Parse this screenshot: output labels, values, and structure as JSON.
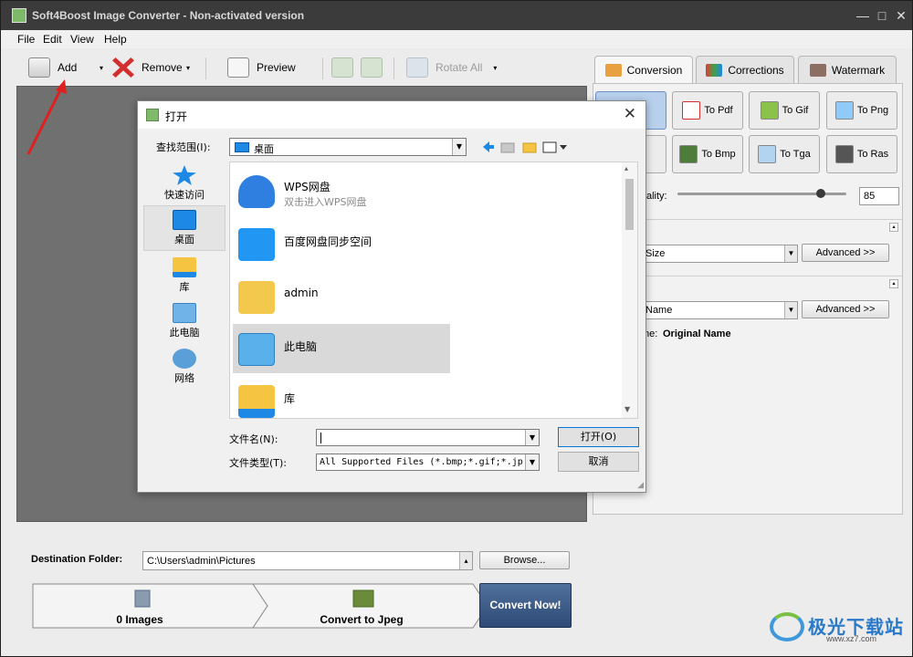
{
  "window": {
    "title": "Soft4Boost Image Converter - Non-activated version",
    "min_glyph": "—",
    "max_glyph": "□",
    "close_glyph": "✕"
  },
  "menu": {
    "file": "File",
    "edit": "Edit",
    "view": "View",
    "help": "Help"
  },
  "toolbar": {
    "add": "Add",
    "remove": "Remove",
    "preview": "Preview",
    "rotate_all": "Rotate All",
    "drop_glyph": "▾"
  },
  "tabs": {
    "conversion": "Conversion",
    "corrections": "Corrections",
    "watermark": "Watermark"
  },
  "formats": {
    "jpg_partial": "g",
    "pdf": "To Pdf",
    "gif": "To Gif",
    "png": "To Png",
    "tiff_partial": "iff",
    "bmp": "To Bmp",
    "tga": "To Tga",
    "ras": "To Ras"
  },
  "quality": {
    "label_partial": "ality:",
    "value": "85",
    "fraction": 0.85
  },
  "size": {
    "value_partial": "Size",
    "advanced": "Advanced >>"
  },
  "name": {
    "value_partial": "Name",
    "advanced": "Advanced >>",
    "info_partial": "me:",
    "info_value": "Original Name"
  },
  "collapse_glyph": "▴",
  "bottom": {
    "dest_label": "Destination Folder:",
    "dest_value": "C:\\Users\\admin\\Pictures",
    "browse": "Browse...",
    "images": "0 Images",
    "convert_to": "Convert to Jpeg",
    "convert_now": "Convert Now!"
  },
  "dialog": {
    "title": "打开",
    "close_glyph": "✕",
    "lookin_label": "查找范围(I):",
    "lookin_value": "桌面",
    "places": [
      "快速访问",
      "桌面",
      "库",
      "此电脑",
      "网络"
    ],
    "files": [
      {
        "name": "WPS网盘",
        "sub": "双击进入WPS网盘"
      },
      {
        "name": "百度网盘同步空间",
        "sub": ""
      },
      {
        "name": "admin",
        "sub": ""
      },
      {
        "name": "此电脑",
        "sub": ""
      },
      {
        "name": "库",
        "sub": ""
      }
    ],
    "filename_label": "文件名(N):",
    "filename_value": "",
    "filetype_label": "文件类型(T):",
    "filetype_value": "All Supported Files (*.bmp;*.gif;*.jp",
    "open": "打开(O)",
    "cancel": "取消",
    "dropdown_glyph": "▼"
  },
  "watermark_site": {
    "name": "极光下载站",
    "url": "www.xz7.com"
  },
  "colors": {
    "titlebar": "#3b3b3b",
    "canvas": "#707070",
    "convert_button": "#3d5a86",
    "selected_format": "#b8d0ec",
    "annotation_arrow": "#e02020"
  }
}
